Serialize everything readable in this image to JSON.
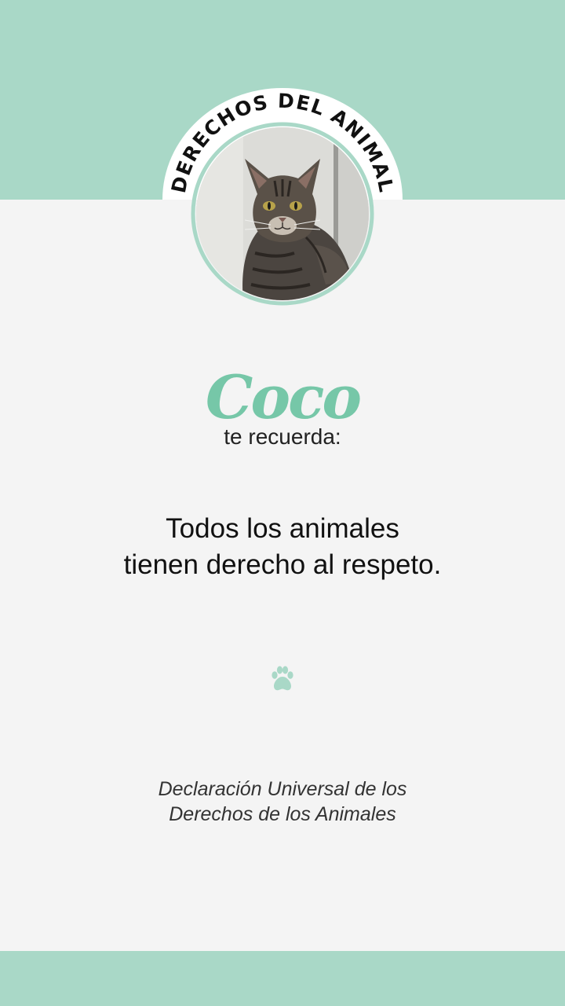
{
  "badge": {
    "arc_text": "DERECHOS DEL ANIMAL"
  },
  "photo": {
    "alt": "cat"
  },
  "name": "Coco",
  "subtitle": "te recuerda:",
  "message": {
    "line1": "Todos los animales",
    "line2": "tienen derecho al respeto."
  },
  "source": {
    "line1": "Declaración Universal de los",
    "line2": "Derechos de los Animales"
  },
  "icons": {
    "paw": "paw-icon"
  },
  "colors": {
    "mint": "#a9d8c7",
    "accent_green": "#76c7a8",
    "background": "#f4f4f4",
    "text": "#111111"
  }
}
